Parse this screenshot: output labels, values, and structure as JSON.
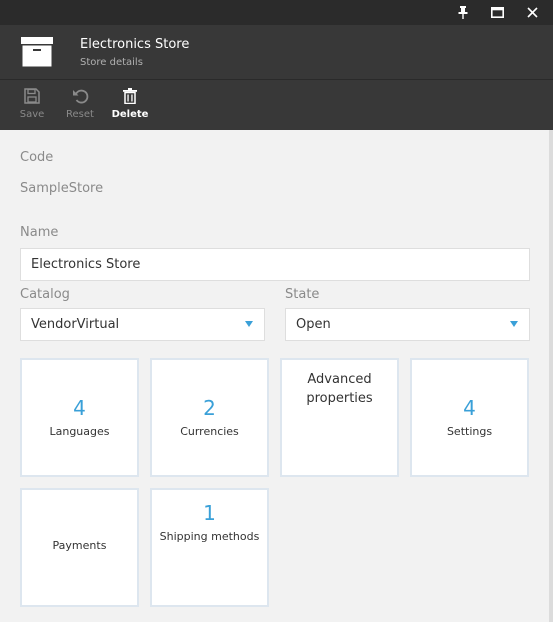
{
  "window": {
    "buttons": [
      "pin",
      "maximize",
      "close"
    ]
  },
  "header": {
    "title": "Electronics Store",
    "subtitle": "Store details",
    "icon": "archive-box-icon"
  },
  "toolbar": {
    "save_label": "Save",
    "reset_label": "Reset",
    "delete_label": "Delete"
  },
  "form": {
    "code_label": "Code",
    "code_value": "SampleStore",
    "name_label": "Name",
    "name_value": "Electronics Store",
    "catalog_label": "Catalog",
    "catalog_value": "VendorVirtual",
    "state_label": "State",
    "state_value": "Open"
  },
  "tiles": {
    "languages": {
      "count": "4",
      "label": "Languages"
    },
    "currencies": {
      "count": "2",
      "label": "Currencies"
    },
    "advanced": {
      "label": "Advanced properties"
    },
    "settings": {
      "count": "4",
      "label": "Settings"
    },
    "payments": {
      "label": "Payments"
    },
    "shipping": {
      "count": "1",
      "label": "Shipping methods"
    }
  },
  "colors": {
    "accent": "#3aa0d8",
    "header_bg": "#383838",
    "titlebar_bg": "#2b2b2b",
    "content_bg": "#f2f2f2"
  }
}
